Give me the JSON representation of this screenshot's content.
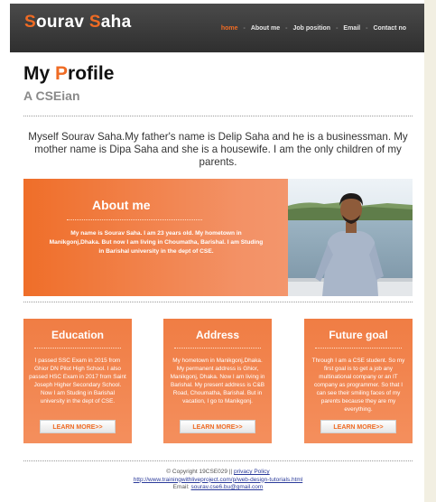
{
  "header": {
    "logo_first_letter": "S",
    "logo_first_rest": "ourav ",
    "logo_last_letter": "S",
    "logo_last_rest": "aha",
    "nav": [
      "home",
      "About me",
      "Job position",
      "Email",
      "Contact no"
    ],
    "active_nav": "home",
    "separator": "-"
  },
  "profile": {
    "title_first": "My ",
    "title_accent": "P",
    "title_rest": "rofile",
    "subtitle": "A CSEian",
    "intro": "Myself Sourav Saha.My father's name is Delip Saha and he is a businessman. My mother name is Dipa Saha and she is a housewife. I am the only children of my parents."
  },
  "about": {
    "title": "About me",
    "text": "My name is Sourav Saha. I am 23 years old. My hometown in Manikgonj,Dhaka. But now I am living in Choumatha, Barishal. I am Studing in Barishal university in the dept of CSE."
  },
  "cards": [
    {
      "title": "Education",
      "text": "I passed SSC Exam in 2015 from Ghior DN Pilot High School. I also passed HSC Exam in 2017 from Saint Joseph Higher Secondary School. Now I am Studing in Barishal university in the dept of CSE.",
      "button": "LEARN MORE>>"
    },
    {
      "title": "Address",
      "text": "My hometown in Manikgonj,Dhaka. My permanent address is Ghior, Manikgonj, Dhaka. Now I am living in Barishal. My present address is C&B Road, Choumatha, Barishal. But in vacation, I go to Manikgonj.",
      "button": "LEARN MORE>>"
    },
    {
      "title": "Future goal",
      "text": "Through I am a CSE student. So my first goal is to get a job any multinational company or an IT company as programmer. So that I can see their smiling faces of my parents because they are my everything.",
      "button": "LEARN MORE>>"
    }
  ],
  "footer": {
    "copyright": "© Copyright 19CSE029 ||",
    "privacy": "privacy Policy",
    "url": "http://www.trainingwithliveproject.com/p/web-design-tutorials.html",
    "email_label": "Email:",
    "email": "sourav.cse6.bu@gmail.com"
  },
  "colors": {
    "accent": "#ef6b24",
    "header_bg": "#3a3a3a",
    "panel": "#f07d44"
  }
}
